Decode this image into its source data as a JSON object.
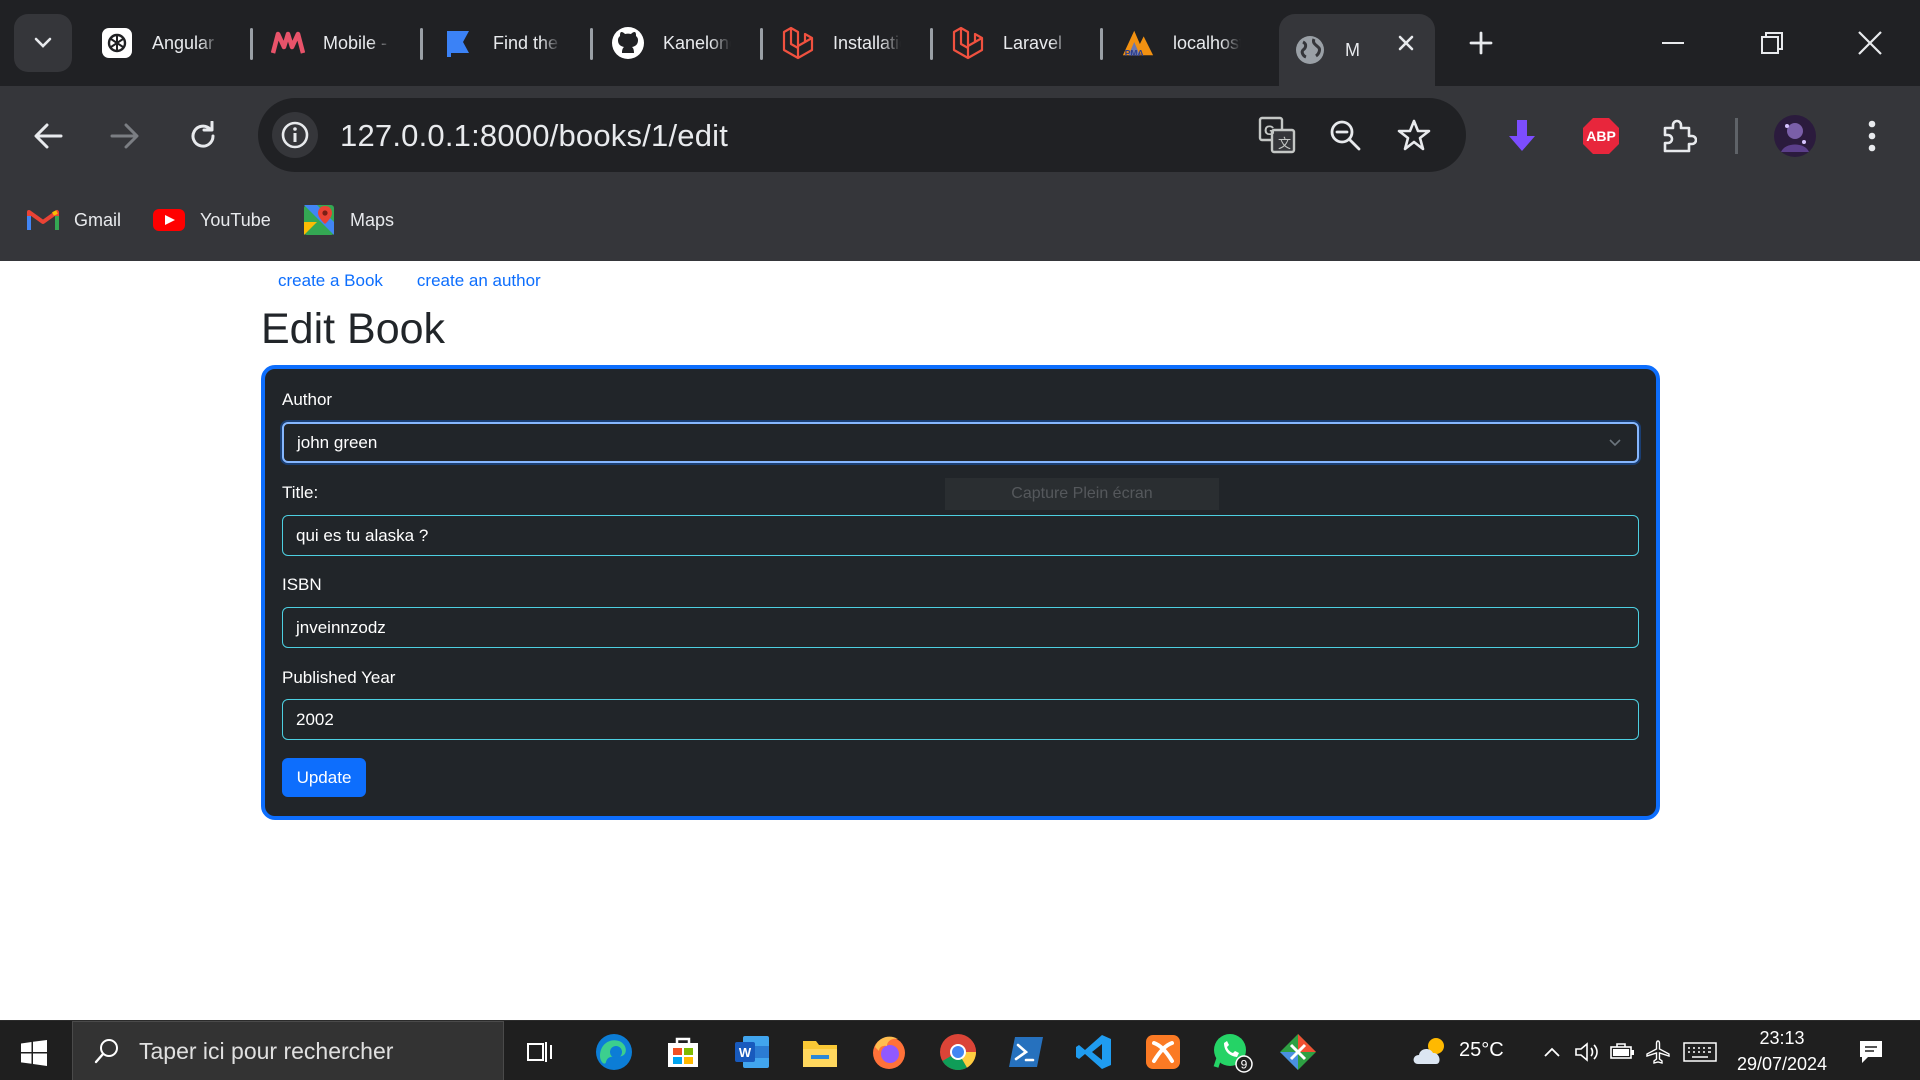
{
  "browser": {
    "tabs": [
      {
        "title": "Angular C",
        "icon": "chatgpt-icon"
      },
      {
        "title": "Mobile -",
        "icon": "m-logo-icon"
      },
      {
        "title": "Find the ",
        "icon": "flag-icon"
      },
      {
        "title": "Kanelone",
        "icon": "github-icon"
      },
      {
        "title": "Installatio",
        "icon": "laravel-icon"
      },
      {
        "title": "Laravel",
        "icon": "laravel-icon"
      },
      {
        "title": "localhost",
        "icon": "phpmyadmin-icon"
      },
      {
        "title": "M",
        "icon": "globe-icon",
        "active": true
      }
    ],
    "url": "127.0.0.1:8000/books/1/edit",
    "bookmarks": [
      {
        "label": "Gmail",
        "icon": "gmail-icon"
      },
      {
        "label": "YouTube",
        "icon": "youtube-icon"
      },
      {
        "label": "Maps",
        "icon": "maps-icon"
      }
    ],
    "extension_badge": "ABP"
  },
  "page": {
    "links": [
      "create a Book",
      "create an author"
    ],
    "title": "Edit Book",
    "form": {
      "author_label": "Author",
      "author_value": "john green",
      "title_label": "Title:",
      "title_value": "qui es tu alaska ?",
      "isbn_label": "ISBN",
      "isbn_value": "jnveinnzodz",
      "year_label": "Published Year",
      "year_value": "2002",
      "submit_label": "Update"
    },
    "overlay_tooltip": "Capture Plein écran"
  },
  "taskbar": {
    "search_placeholder": "Taper ici pour rechercher",
    "weather": "25°C",
    "time": "23:13",
    "date": "29/07/2024",
    "whatsapp_badge": "9"
  },
  "colors": {
    "accent": "#0d6efd",
    "card_bg": "#212529",
    "browser_dark": "#202124",
    "browser_toolbar": "#35363a"
  }
}
